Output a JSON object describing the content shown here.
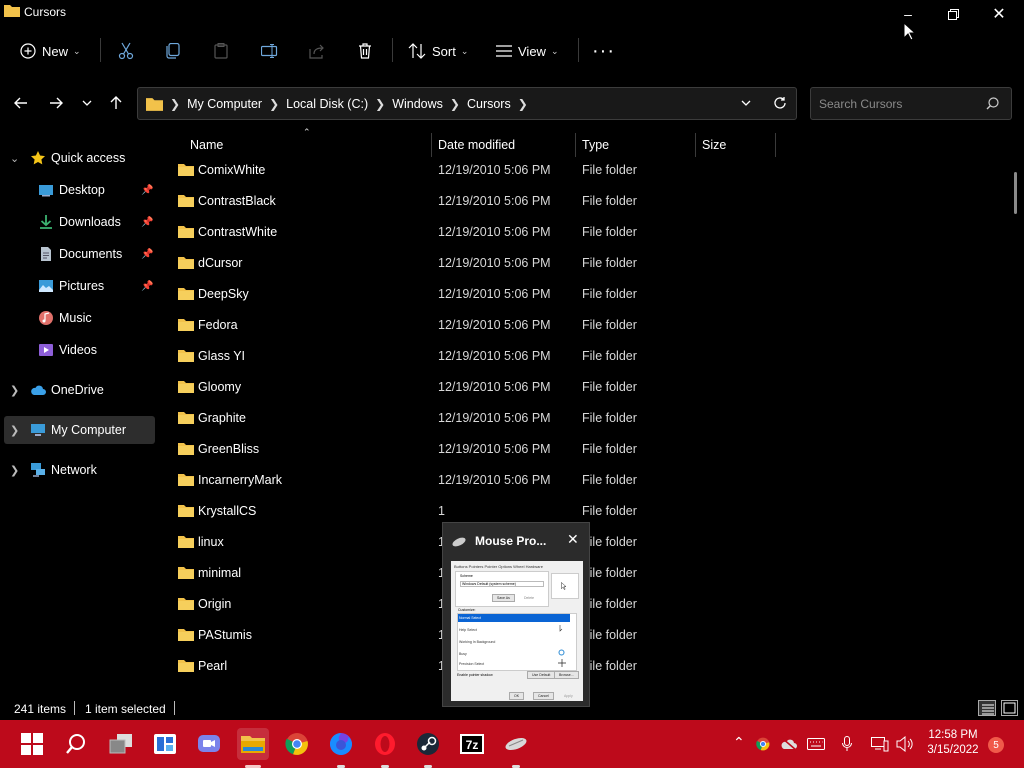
{
  "window": {
    "title": "Cursors"
  },
  "toolbar": {
    "new_label": "New",
    "sort_label": "Sort",
    "view_label": "View"
  },
  "address": {
    "crumbs": [
      "My Computer",
      "Local Disk (C:)",
      "Windows",
      "Cursors"
    ],
    "search_placeholder": "Search Cursors"
  },
  "sidebar": {
    "quick_access": "Quick access",
    "items": [
      {
        "label": "Desktop",
        "pinned": true
      },
      {
        "label": "Downloads",
        "pinned": true
      },
      {
        "label": "Documents",
        "pinned": true
      },
      {
        "label": "Pictures",
        "pinned": true
      },
      {
        "label": "Music",
        "pinned": false
      },
      {
        "label": "Videos",
        "pinned": false
      }
    ],
    "onedrive": "OneDrive",
    "my_computer": "My Computer",
    "network": "Network"
  },
  "columns": {
    "name": "Name",
    "date": "Date modified",
    "type": "Type",
    "size": "Size"
  },
  "files": [
    {
      "name": "ComixBlack",
      "date": "12/19/2010 5:06 PM",
      "type": "File folder"
    },
    {
      "name": "ComixWhite",
      "date": "12/19/2010 5:06 PM",
      "type": "File folder"
    },
    {
      "name": "ContrastBlack",
      "date": "12/19/2010 5:06 PM",
      "type": "File folder"
    },
    {
      "name": "ContrastWhite",
      "date": "12/19/2010 5:06 PM",
      "type": "File folder"
    },
    {
      "name": "dCursor",
      "date": "12/19/2010 5:06 PM",
      "type": "File folder"
    },
    {
      "name": "DeepSky",
      "date": "12/19/2010 5:06 PM",
      "type": "File folder"
    },
    {
      "name": "Fedora",
      "date": "12/19/2010 5:06 PM",
      "type": "File folder"
    },
    {
      "name": "Glass YI",
      "date": "12/19/2010 5:06 PM",
      "type": "File folder"
    },
    {
      "name": "Gloomy",
      "date": "12/19/2010 5:06 PM",
      "type": "File folder"
    },
    {
      "name": "Graphite",
      "date": "12/19/2010 5:06 PM",
      "type": "File folder"
    },
    {
      "name": "GreenBliss",
      "date": "12/19/2010 5:06 PM",
      "type": "File folder"
    },
    {
      "name": "IncarnerryMark",
      "date": "12/19/2010 5:06 PM",
      "type": "File folder"
    },
    {
      "name": "KrystallCS",
      "date": "1",
      "type": "File folder"
    },
    {
      "name": "linux",
      "date": "1",
      "type": "File folder"
    },
    {
      "name": "minimal",
      "date": "1",
      "type": "File folder"
    },
    {
      "name": "Origin",
      "date": "1",
      "type": "File folder"
    },
    {
      "name": "PAStumis",
      "date": "1",
      "type": "File folder"
    },
    {
      "name": "Pearl",
      "date": "1",
      "type": "File folder"
    }
  ],
  "status": {
    "count": "241 items",
    "selected": "1 item selected"
  },
  "popup": {
    "title": "Mouse Pro...",
    "preview_text": {
      "tabs": "Buttons Pointers Pointer Options Wheel Hardware",
      "scheme_label": "Scheme",
      "scheme_value": "Windows Default (system scheme)",
      "save_as": "Save As",
      "delete": "Delete",
      "customize": "Customize:",
      "items": [
        "Normal Select",
        "Help Select",
        "Working In Background",
        "Busy",
        "Precision Select"
      ],
      "shadow": "Enable pointer shadow",
      "use_default": "Use Default",
      "browse": "Browse...",
      "ok": "OK",
      "cancel": "Cancel",
      "apply": "Apply"
    }
  },
  "clock": {
    "time": "12:58 PM",
    "date": "3/15/2022"
  },
  "notifications": {
    "count": "5"
  },
  "colors": {
    "taskbar": "#bd0a1b",
    "folder": "#f2c24a",
    "accent": "#0a64d4"
  }
}
